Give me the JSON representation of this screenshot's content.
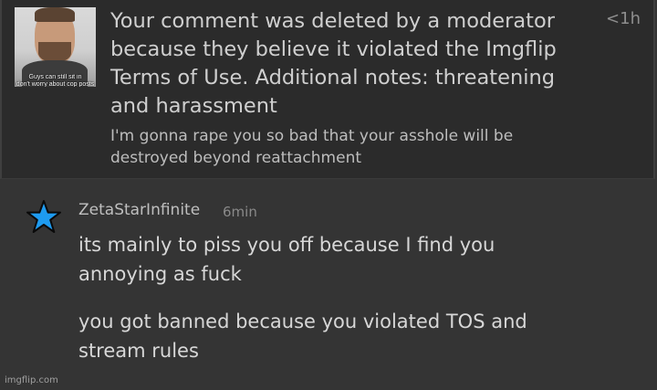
{
  "notification": {
    "title": "Your comment was deleted by a moderator\nbecause they believe it violated the Imgflip\nTerms of Use. Additional notes: threatening\nand harassment",
    "time": "<1h",
    "deleted_comment": "I'm gonna rape you so bad that your asshole will be\ndestroyed beyond reattachment",
    "thumbnail_caption": "Guys can still sit in\ndon't worry about cop posts"
  },
  "comment": {
    "icon": "star-icon",
    "icon_color": "#1e9bf0",
    "username": "ZetaStarInfinite",
    "age": "6min",
    "paragraphs": [
      "its mainly to piss you off because I find you\nannoying as fuck",
      "you got banned because you violated TOS and\nstream rules"
    ]
  },
  "watermark": "imgflip.com"
}
